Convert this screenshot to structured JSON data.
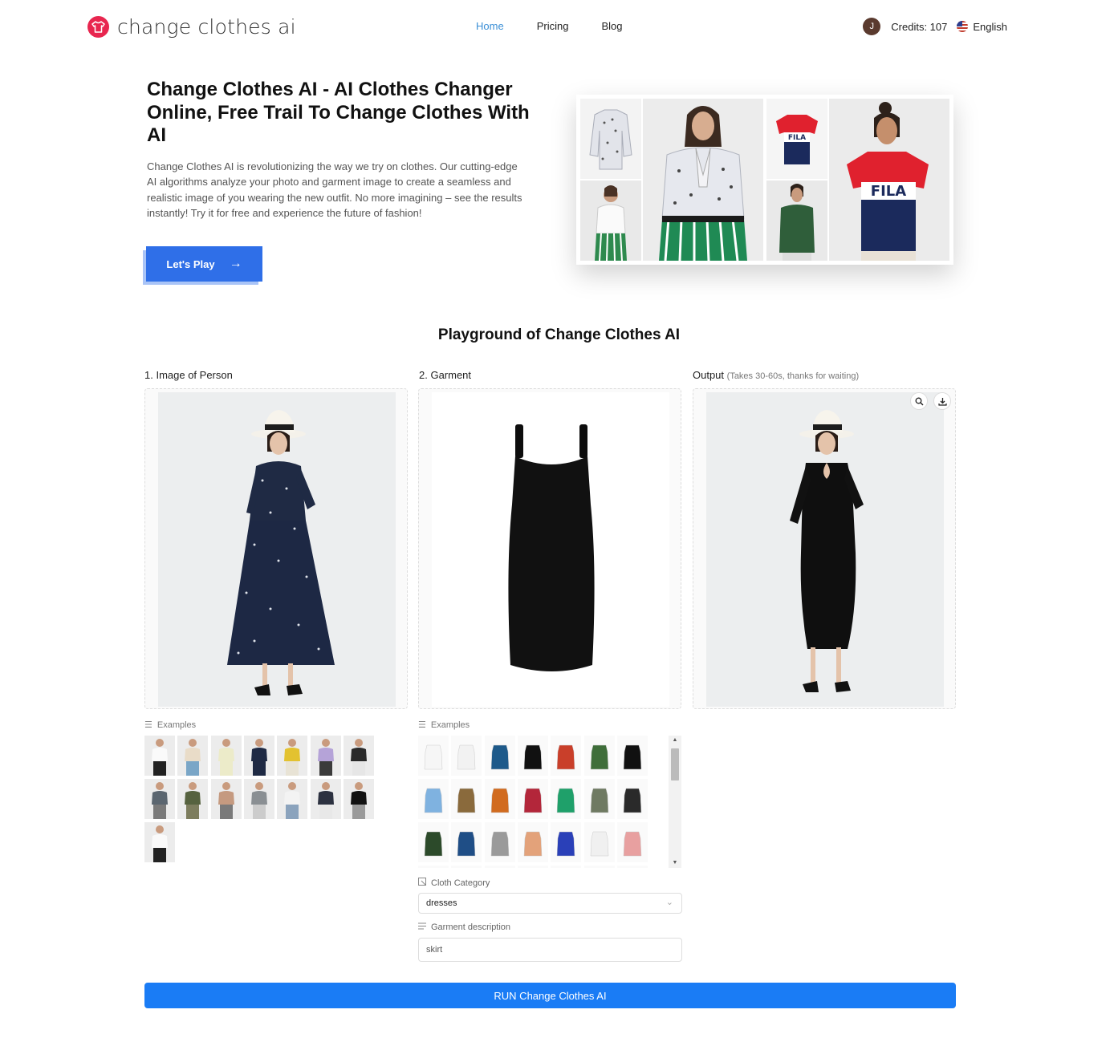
{
  "brand": {
    "name": "change clothes ai",
    "accent": "#e8264f"
  },
  "nav": {
    "items": [
      {
        "label": "Home",
        "active": true
      },
      {
        "label": "Pricing",
        "active": false
      },
      {
        "label": "Blog",
        "active": false
      }
    ]
  },
  "user": {
    "avatar_initial": "J",
    "credits": "Credits: 107",
    "language": "English"
  },
  "hero": {
    "title": "Change Clothes AI - AI Clothes Changer Online, Free Trail To Change Clothes With AI",
    "description": "Change Clothes AI is revolutionizing the way we try on clothes. Our cutting-edge AI algorithms analyze your photo and garment image to create a seamless and realistic image of you wearing the new outfit. No more imagining – see the results instantly! Try it for free and experience the future of fashion!",
    "cta_label": "Let's Play",
    "cta_color": "#2f6fe8"
  },
  "playground": {
    "title": "Playground of Change Clothes AI",
    "person_label": "1. Image of Person",
    "garment_label": "2. Garment",
    "output_label": "Output",
    "output_note": "(Takes 30-60s, thanks for waiting)",
    "examples_label": "Examples",
    "garment_examples_label": "Examples",
    "cloth_category_label": "Cloth Category",
    "cloth_category_value": "dresses",
    "garment_description_label": "Garment description",
    "garment_description_value": "skirt",
    "run_label": "RUN Change Clothes AI",
    "run_color": "#1a7cf5"
  }
}
